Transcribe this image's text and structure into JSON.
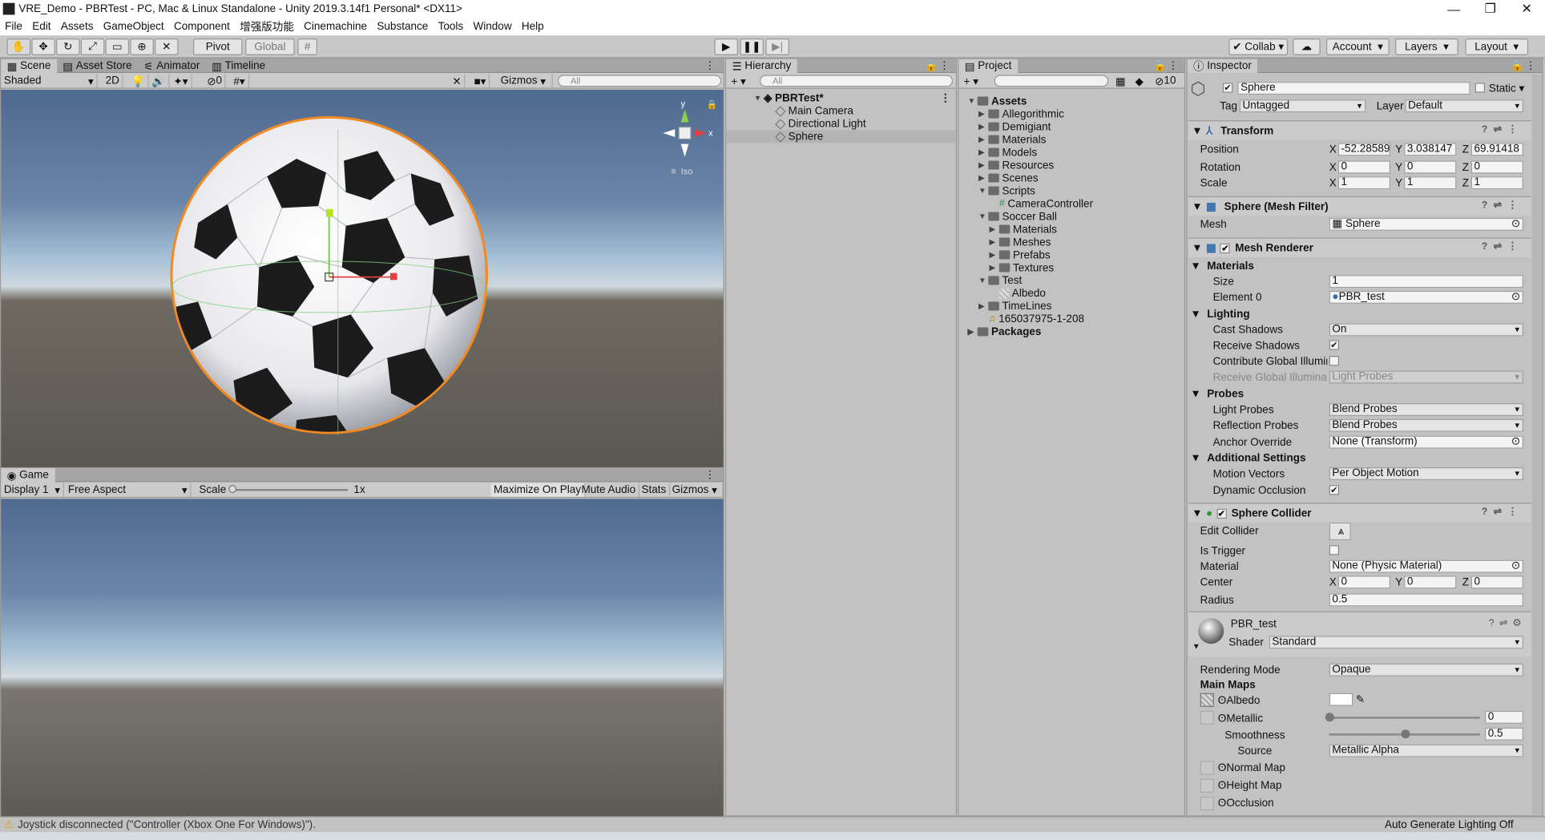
{
  "window": {
    "title": "VRE_Demo - PBRTest - PC, Mac & Linux Standalone - Unity 2019.3.14f1 Personal* <DX11>"
  },
  "menu": [
    "File",
    "Edit",
    "Assets",
    "GameObject",
    "Component",
    "增强版功能",
    "Cinemachine",
    "Substance",
    "Tools",
    "Window",
    "Help"
  ],
  "toolbar": {
    "pivot": "Pivot",
    "global": "Global",
    "collab": "Collab",
    "account": "Account",
    "layers": "Layers",
    "layout": "Layout"
  },
  "scene": {
    "tabs": [
      "Scene",
      "Asset Store",
      "Animator",
      "Timeline"
    ],
    "shading": "Shaded",
    "mode2d": "2D",
    "hidden_count": "0",
    "gizmos": "Gizmos",
    "search_placeholder": "All",
    "iso": "Iso",
    "axis_y": "y",
    "axis_x": "x"
  },
  "game": {
    "tab": "Game",
    "display": "Display 1",
    "aspect": "Free Aspect",
    "scale_label": "Scale",
    "scale_value": "1x",
    "maximize": "Maximize On Play",
    "mute": "Mute Audio",
    "stats": "Stats",
    "gizmos": "Gizmos"
  },
  "hierarchy": {
    "tab": "Hierarchy",
    "search_placeholder": "All",
    "scene": "PBRTest*",
    "items": [
      "Main Camera",
      "Directional Light",
      "Sphere"
    ]
  },
  "project": {
    "tab": "Project",
    "hidden_count": "10",
    "tree": [
      {
        "label": "Assets",
        "depth": 0,
        "arrow": "▼",
        "bold": true
      },
      {
        "label": "Allegorithmic",
        "depth": 1,
        "arrow": "▶"
      },
      {
        "label": "Demigiant",
        "depth": 1,
        "arrow": "▶"
      },
      {
        "label": "Materials",
        "depth": 1,
        "arrow": "▶"
      },
      {
        "label": "Models",
        "depth": 1,
        "arrow": "▶"
      },
      {
        "label": "Resources",
        "depth": 1,
        "arrow": "▶"
      },
      {
        "label": "Scenes",
        "depth": 1,
        "arrow": "▶"
      },
      {
        "label": "Scripts",
        "depth": 1,
        "arrow": "▼"
      },
      {
        "label": "CameraController",
        "depth": 2,
        "arrow": "",
        "icon": "script"
      },
      {
        "label": "Soccer Ball",
        "depth": 1,
        "arrow": "▼"
      },
      {
        "label": "Materials",
        "depth": 2,
        "arrow": "▶"
      },
      {
        "label": "Meshes",
        "depth": 2,
        "arrow": "▶"
      },
      {
        "label": "Prefabs",
        "depth": 2,
        "arrow": "▶"
      },
      {
        "label": "Textures",
        "depth": 2,
        "arrow": "▶"
      },
      {
        "label": "Test",
        "depth": 1,
        "arrow": "▼"
      },
      {
        "label": "Albedo",
        "depth": 2,
        "arrow": "",
        "icon": "texture"
      },
      {
        "label": "TimeLines",
        "depth": 1,
        "arrow": "▶"
      },
      {
        "label": "165037975-1-208",
        "depth": 1,
        "arrow": "",
        "icon": "audio"
      },
      {
        "label": "Packages",
        "depth": 0,
        "arrow": "▶",
        "bold": true
      }
    ]
  },
  "inspector": {
    "tab": "Inspector",
    "name": "Sphere",
    "static": "Static",
    "tag_label": "Tag",
    "tag": "Untagged",
    "layer_label": "Layer",
    "layer": "Default",
    "transform": {
      "title": "Transform",
      "position_label": "Position",
      "rotation_label": "Rotation",
      "scale_label": "Scale",
      "position": [
        "-52.28589",
        "3.038147",
        "69.91418"
      ],
      "rotation": [
        "0",
        "0",
        "0"
      ],
      "scale": [
        "1",
        "1",
        "1"
      ],
      "axes": [
        "X",
        "Y",
        "Z"
      ]
    },
    "mesh_filter": {
      "title": "Sphere (Mesh Filter)",
      "mesh_label": "Mesh",
      "mesh": "Sphere"
    },
    "mesh_renderer": {
      "title": "Mesh Renderer",
      "materials": "Materials",
      "size_label": "Size",
      "size": "1",
      "element0_label": "Element 0",
      "element0": "PBR_test",
      "lighting": "Lighting",
      "cast_shadows_label": "Cast Shadows",
      "cast_shadows": "On",
      "receive_shadows_label": "Receive Shadows",
      "contribute_gi_label": "Contribute Global Illumina",
      "receive_gi_label": "Receive Global Illuminatic",
      "receive_gi": "Light Probes",
      "probes": "Probes",
      "light_probes_label": "Light Probes",
      "light_probes": "Blend Probes",
      "reflection_probes_label": "Reflection Probes",
      "reflection_probes": "Blend Probes",
      "anchor_override_label": "Anchor Override",
      "anchor_override": "None (Transform)",
      "additional": "Additional Settings",
      "motion_vectors_label": "Motion Vectors",
      "motion_vectors": "Per Object Motion",
      "dynamic_occlusion_label": "Dynamic Occlusion"
    },
    "sphere_collider": {
      "title": "Sphere Collider",
      "edit_collider_label": "Edit Collider",
      "is_trigger_label": "Is Trigger",
      "material_label": "Material",
      "material": "None (Physic Material)",
      "center_label": "Center",
      "center": [
        "0",
        "0",
        "0"
      ],
      "radius_label": "Radius",
      "radius": "0.5"
    },
    "material": {
      "name": "PBR_test",
      "shader_label": "Shader",
      "shader": "Standard",
      "rendering_mode_label": "Rendering Mode",
      "rendering_mode": "Opaque",
      "main_maps": "Main Maps",
      "albedo": "Albedo",
      "metallic": "Metallic",
      "metallic_value": "0",
      "smoothness": "Smoothness",
      "smoothness_value": "0.5",
      "source_label": "Source",
      "source": "Metallic Alpha",
      "normal_map": "Normal Map",
      "height_map": "Height Map",
      "occlusion": "Occlusion"
    }
  },
  "status": {
    "message": "Joystick disconnected (\"Controller (Xbox One For Windows)\").",
    "right": "Auto Generate Lighting Off"
  },
  "colors": {
    "accent_orange": "#f08a24",
    "selection": "#b4b4b4"
  }
}
